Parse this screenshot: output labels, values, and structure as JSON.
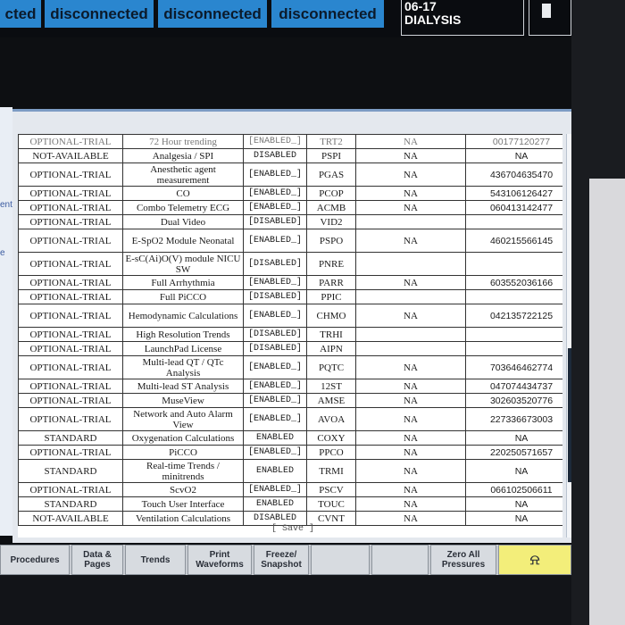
{
  "top_bar": {
    "connections": [
      "cted",
      "disconnected",
      "disconnected",
      "disconnected"
    ],
    "bed_label_line1": "06-17",
    "bed_label_line2": "DIALYSIS"
  },
  "left_edge": [
    "ent",
    "e"
  ],
  "options_table": {
    "partial_top_row": [
      "OPTIONAL-TRIAL",
      "72 Hour trending",
      "[ENABLED_]",
      "TRT2",
      "NA",
      "00177120277"
    ],
    "rows": [
      [
        "NOT-AVAILABLE",
        "Analgesia / SPI",
        "DISABLED",
        "PSPI",
        "NA",
        "NA"
      ],
      [
        "OPTIONAL-TRIAL",
        "Anesthetic agent measurement",
        "[ENABLED_]",
        "PGAS",
        "NA",
        "436704635470"
      ],
      [
        "OPTIONAL-TRIAL",
        "CO",
        "[ENABLED_]",
        "PCOP",
        "NA",
        "543106126427"
      ],
      [
        "OPTIONAL-TRIAL",
        "Combo Telemetry ECG",
        "[ENABLED_]",
        "ACMB",
        "NA",
        "060413142477"
      ],
      [
        "OPTIONAL-TRIAL",
        "Dual Video",
        "[DISABLED]",
        "VID2",
        "",
        ""
      ],
      [
        "OPTIONAL-TRIAL",
        "E-SpO2 Module Neonatal",
        "[ENABLED_]",
        "PSPO",
        "NA",
        "460215566145"
      ],
      [
        "OPTIONAL-TRIAL",
        "E-sC(Ai)O(V) module NICU SW",
        "[DISABLED]",
        "PNRE",
        "",
        ""
      ],
      [
        "OPTIONAL-TRIAL",
        "Full Arrhythmia",
        "[ENABLED_]",
        "PARR",
        "NA",
        "603552036166"
      ],
      [
        "OPTIONAL-TRIAL",
        "Full PiCCO",
        "[DISABLED]",
        "PPIC",
        "",
        ""
      ],
      [
        "OPTIONAL-TRIAL",
        "Hemodynamic Calculations",
        "[ENABLED_]",
        "CHMO",
        "NA",
        "042135722125"
      ],
      [
        "OPTIONAL-TRIAL",
        "High Resolution Trends",
        "[DISABLED]",
        "TRHI",
        "",
        ""
      ],
      [
        "OPTIONAL-TRIAL",
        "LaunchPad License",
        "[DISABLED]",
        "AIPN",
        "",
        ""
      ],
      [
        "OPTIONAL-TRIAL",
        "Multi-lead QT / QTc Analysis",
        "[ENABLED_]",
        "PQTC",
        "NA",
        "703646462774"
      ],
      [
        "OPTIONAL-TRIAL",
        "Multi-lead ST Analysis",
        "[ENABLED_]",
        "12ST",
        "NA",
        "047074434737"
      ],
      [
        "OPTIONAL-TRIAL",
        "MuseView",
        "[ENABLED_]",
        "AMSE",
        "NA",
        "302603520776"
      ],
      [
        "OPTIONAL-TRIAL",
        "Network and Auto Alarm View",
        "[ENABLED_]",
        "AVOA",
        "NA",
        "227336673003"
      ],
      [
        "STANDARD",
        "Oxygenation Calculations",
        "ENABLED",
        "COXY",
        "NA",
        "NA"
      ],
      [
        "OPTIONAL-TRIAL",
        "PiCCO",
        "[ENABLED_]",
        "PPCO",
        "NA",
        "220250571657"
      ],
      [
        "STANDARD",
        "Real-time Trends / minitrends",
        "ENABLED",
        "TRMI",
        "NA",
        "NA"
      ],
      [
        "OPTIONAL-TRIAL",
        "ScvO2",
        "[ENABLED_]",
        "PSCV",
        "NA",
        "066102506611"
      ],
      [
        "STANDARD",
        "Touch User Interface",
        "ENABLED",
        "TOUC",
        "NA",
        "NA"
      ],
      [
        "NOT-AVAILABLE",
        "Ventilation Calculations",
        "DISABLED",
        "CVNT",
        "NA",
        "NA"
      ]
    ],
    "save_label": "[ Save ]"
  },
  "softkeys": [
    {
      "name": "procedures",
      "label": "Procedures"
    },
    {
      "name": "data-pages",
      "label": "Data &\nPages"
    },
    {
      "name": "trends",
      "label": "Trends"
    },
    {
      "name": "print-waveforms",
      "label": "Print\nWaveforms"
    },
    {
      "name": "freeze-snapshot",
      "label": "Freeze/\nSnapshot"
    },
    {
      "name": "blank-1",
      "label": ""
    },
    {
      "name": "blank-2",
      "label": ""
    },
    {
      "name": "zero-all-pressures",
      "label": "Zero All\nPressures"
    },
    {
      "name": "alarm-silence",
      "label": ""
    }
  ],
  "colors": {
    "connection_blue": "#2a86cf",
    "alarm_yellow": "#f3ee7a"
  }
}
